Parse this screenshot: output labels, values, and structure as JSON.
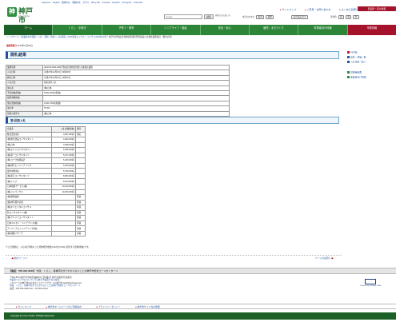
{
  "header": {
    "logo_mark": "神",
    "city_name": "神戸市",
    "city_name_en": "City of Kobe",
    "languages": [
      "Japanese",
      "English",
      "簡体中文",
      "繁體中文",
      "한국어",
      "Tiếng Việt",
      "Français",
      "Español",
      "Português",
      "Indonesia"
    ],
    "top_links": [
      "サイトマップ",
      "ご意見・お問い合わせ",
      "よくある質問と回答"
    ],
    "ward_button": "区役所・区の情報",
    "search_placeholder": "Google",
    "search_button": "検索",
    "search_options": "検索方法の使い方",
    "util_font_label": "文字の大きさ",
    "util_font_options": [
      "拡大",
      "標準"
    ],
    "util_voice_label": "音声読み上げ",
    "util_color_label": "背景色",
    "util_color_options": [
      "青",
      "黄",
      "黒"
    ]
  },
  "nav": [
    "ホーム",
    "くらし・手続き",
    "子育て・教育",
    "シニアライフ・福祉",
    "安全・安心",
    "観光・まちづくり",
    "事業者向け情報",
    "市政情報"
  ],
  "breadcrumb": {
    "items": [
      "トップページ",
      "事業者向け情報",
      "入札・契約・調達",
      "入札情報",
      "2015年度コンサル",
      "コンサル2015年10月"
    ],
    "current": "神戸市行財政局契約監理課等所管施設の点検等業務委託（都市計画）"
  },
  "updated": {
    "label": "最終更新日",
    "value": "2015年12月25日"
  },
  "main": {
    "title": "開札結果",
    "info_rows": [
      {
        "label": "業務名称",
        "value": "(2015-R1022-000)行財政局契約監理課 点検委託業務"
      },
      {
        "label": "入札日時",
        "value": "平成27年12月16日 10時00分"
      },
      {
        "label": "開札日時",
        "value": "平成27年12月16日 10時30分"
      },
      {
        "label": "入札方式",
        "value": "指名競争入札"
      },
      {
        "label": "落札者",
        "value": "(株)日本"
      },
      {
        "label": "予定価格(税抜)",
        "value": "5,864,000円(税抜)"
      },
      {
        "label": "最低制限価格",
        "value": ""
      },
      {
        "label": "落札金額(税抜)",
        "value": "4,664,750円(税抜)"
      },
      {
        "label": "落札率",
        "value": "79.5%"
      },
      {
        "label": "契約の相手方",
        "value": "(株)日本"
      }
    ],
    "round_title": "第1回目入札",
    "bid_headers": [
      "企業名",
      "入札金額(税抜)",
      "備考"
    ],
    "bids": [
      {
        "name": "株式会社(株)",
        "amount": "4,837,000円",
        "note": "落札"
      },
      {
        "name": "(株)総合建設コンサルタント",
        "amount": "4,942,000円",
        "note": ""
      },
      {
        "name": "(株)日本",
        "amount": "4,938,000円",
        "note": ""
      },
      {
        "name": "(株)エルフコンサルタント",
        "amount": "5,065,000円",
        "note": ""
      },
      {
        "name": "(株)第一コンサルタンツ",
        "amount": "5,157,000円",
        "note": ""
      },
      {
        "name": "(株)コーワ技建設計",
        "amount": "5,200,000円",
        "note": ""
      },
      {
        "name": "(株)神戸エンジニアリング",
        "amount": "5,220,000円",
        "note": ""
      },
      {
        "name": "都市地研(株)",
        "amount": "8,790,000円",
        "note": ""
      },
      {
        "name": "(株)東京コンサルタンツ",
        "amount": "8,800,000円",
        "note": ""
      },
      {
        "name": "(株)シンワ",
        "amount": "8,100,000円",
        "note": ""
      },
      {
        "name": "日本技術サービス(株)",
        "amount": "10,100,000円",
        "note": ""
      },
      {
        "name": "(株)ジャパックス",
        "amount": "10,400,000円",
        "note": ""
      },
      {
        "name": "(株)関西技建",
        "amount": "",
        "note": "辞退"
      },
      {
        "name": "(株)神戸都市計画",
        "amount": "",
        "note": "辞退"
      },
      {
        "name": "(株)オリエンタルコンサル",
        "amount": "",
        "note": "辞退"
      },
      {
        "name": "新コンサルタンツ(株)",
        "amount": "",
        "note": "辞退"
      },
      {
        "name": "(株)アルファコンサルタント",
        "amount": "",
        "note": "辞退"
      },
      {
        "name": "日本ユニオン・メンテナンス(株)",
        "amount": "",
        "note": "辞退"
      },
      {
        "name": "アイティアエンジニアリング(株)",
        "amount": "",
        "note": "辞退"
      },
      {
        "name": "(株)地盤リサーチ",
        "amount": "",
        "note": "未着"
      }
    ],
    "note": "※上記金額は、入札者が見積もった契約希望金額の110分の100に相当する金額(税抜)です。",
    "pager_prev": "前のページへ",
    "pager_next": "ページの先頭へ"
  },
  "sidebar": {
    "links": [
      {
        "label": "PDF版",
        "color": "#c8102e"
      },
      {
        "label": "認定・評価一覧",
        "color": "#1d4f9e"
      },
      {
        "label": "入札予定一覧へ",
        "color": "#1d4f9e"
      },
      {
        "label": "印刷用画面",
        "color": "#2d8538"
      },
      {
        "label": "事業者向け情報",
        "color": "#2d8538"
      }
    ]
  },
  "footer": {
    "contact_label": "【電話：078-333-3330】",
    "contact_text": "市政、くらし、各種手続きでわからないことは神戸市総合コールセンターへ",
    "address_lines": [
      "〒650-8570 神戸市中央区加納町6丁目5番1号 神戸市役所(代表番号)",
      "市役所へのアクセスについては神戸市役所庁舎の案内",
      "このページは神戸市の公式ホームページです。(C) 神戸市 All Rights Reserved.",
      "市政、くらし、各種手続きでわからないことは神戸市総合コールセンターへ",
      "電話：078-333-3330 Fax：078-333-3314"
    ],
    "unesco_text": "Creative City of Design KOBE",
    "links": [
      "サイトマップ",
      "神戸市ホームページのご利用案内",
      "プライバシーポリシー",
      "神戸市サイト内の地図"
    ],
    "copyright": "Copyright (C) City of Kobe. All Rights Reserved."
  }
}
